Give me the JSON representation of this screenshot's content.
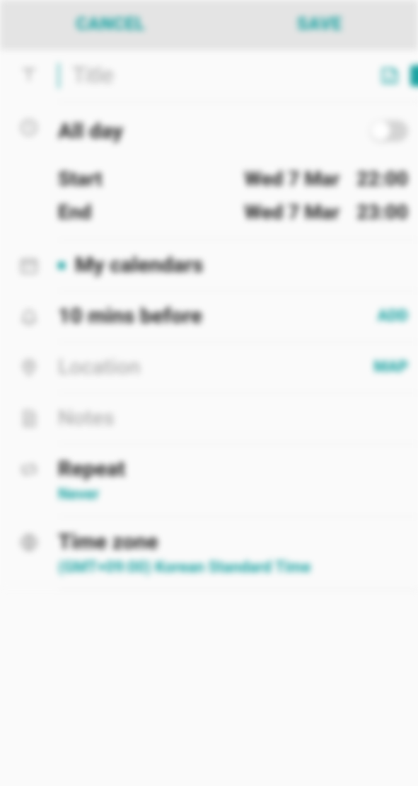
{
  "header": {
    "cancel": "CANCEL",
    "save": "SAVE"
  },
  "title": {
    "placeholder": "Title",
    "value": ""
  },
  "color_swatch": "#1aa3a2",
  "allday": {
    "label": "All day",
    "on": false
  },
  "start": {
    "label": "Start",
    "date": "Wed 7 Mar",
    "time": "22:00"
  },
  "end": {
    "label": "End",
    "date": "Wed 7 Mar",
    "time": "23:00"
  },
  "calendar": {
    "name": "My calendars"
  },
  "reminder": {
    "text": "10 mins before",
    "add_label": "ADD"
  },
  "location": {
    "placeholder": "Location",
    "map_label": "MAP"
  },
  "notes": {
    "placeholder": "Notes"
  },
  "repeat": {
    "label": "Repeat",
    "value": "Never"
  },
  "timezone": {
    "label": "Time zone",
    "value": "(GMT+09:00) Korean Standard Time"
  }
}
